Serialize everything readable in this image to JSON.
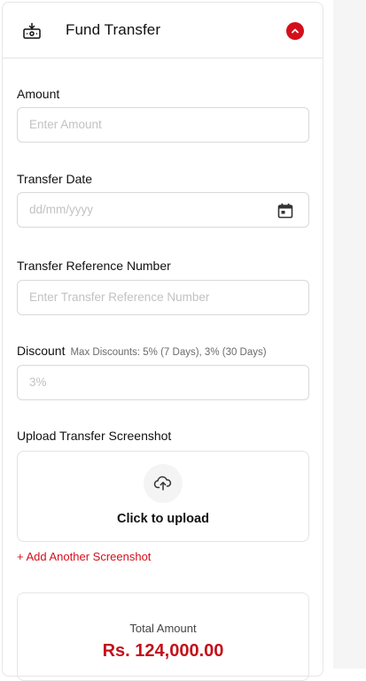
{
  "header": {
    "title": "Fund Transfer",
    "icon": "money-transfer-icon",
    "toggle_icon": "chevron-up-icon"
  },
  "fields": {
    "amount": {
      "label": "Amount",
      "placeholder": "Enter Amount"
    },
    "transfer_date": {
      "label": "Transfer Date",
      "placeholder": "dd/mm/yyyy",
      "icon": "calendar-icon"
    },
    "reference": {
      "label": "Transfer Reference Number",
      "placeholder": "Enter Transfer Reference Number"
    },
    "discount": {
      "label": "Discount",
      "hint": "Max Discounts: 5% (7 Days), 3% (30 Days)",
      "placeholder": "3%"
    }
  },
  "upload": {
    "label": "Upload Transfer Screenshot",
    "cta": "Click to upload",
    "icon": "cloud-upload-icon",
    "add_another": "+ Add Another Screenshot"
  },
  "total": {
    "label": "Total Amount",
    "value": "Rs. 124,000.00"
  },
  "colors": {
    "accent": "#d40f1a",
    "border": "#d9d9d9",
    "placeholder": "#c2c2c2"
  }
}
